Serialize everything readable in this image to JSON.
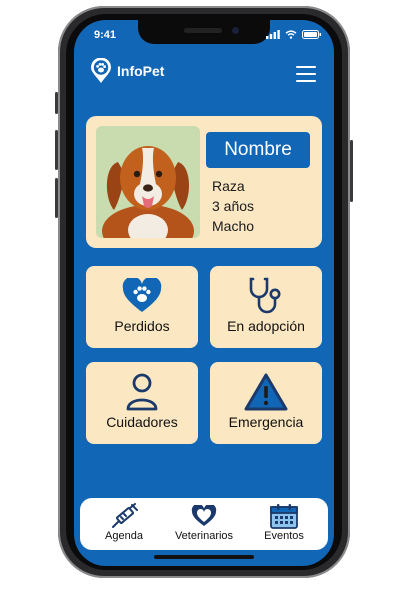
{
  "status": {
    "time": "9:41"
  },
  "app": {
    "title": "InfoPet"
  },
  "pet": {
    "name": "Nombre",
    "breed": "Raza",
    "age": "3 años",
    "sex": "Macho"
  },
  "tiles": [
    {
      "label": "Perdidos",
      "icon": "heart-paw-icon"
    },
    {
      "label": "En adopción",
      "icon": "stethoscope-icon"
    },
    {
      "label": "Cuidadores",
      "icon": "person-icon"
    },
    {
      "label": "Emergencia",
      "icon": "warning-icon"
    }
  ],
  "nav": [
    {
      "label": "Agenda",
      "icon": "syringe-icon"
    },
    {
      "label": "Veterinarios",
      "icon": "heart-icon"
    },
    {
      "label": "Eventos",
      "icon": "calendar-icon"
    }
  ],
  "colors": {
    "primary": "#1266b6",
    "card": "#fbe8c2",
    "dark": "#1b3a6b"
  }
}
